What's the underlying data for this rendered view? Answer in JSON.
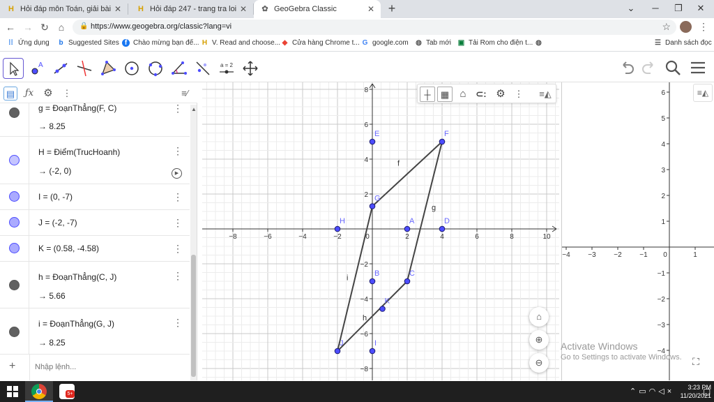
{
  "browser": {
    "tabs": [
      {
        "title": "Hỏi đáp môn Toán, giải bài tập c",
        "icon": "hoidap-icon",
        "active": false
      },
      {
        "title": "Hỏi đáp 247 - trang tra loi",
        "icon": "hoidap-icon",
        "active": false
      },
      {
        "title": "GeoGebra Classic",
        "icon": "geogebra-icon",
        "active": true
      }
    ],
    "url": "https://www.geogebra.org/classic?lang=vi",
    "bookmarks": [
      {
        "label": "Ứng dụng",
        "icon": "apps-icon"
      },
      {
        "label": "Suggested Sites",
        "icon": "bing-icon"
      },
      {
        "label": "Chào mừng bạn đế...",
        "icon": "facebook-icon"
      },
      {
        "label": "V. Read and choose...",
        "icon": "hoidap-icon"
      },
      {
        "label": "Cửa hàng Chrome t...",
        "icon": "chrome-store-icon"
      },
      {
        "label": "google.com",
        "icon": "google-icon"
      },
      {
        "label": "Tab mới",
        "icon": "globe-icon"
      },
      {
        "label": "Tải Rom cho điện t...",
        "icon": "rom-icon"
      }
    ],
    "reading_list": "Danh sách đọc"
  },
  "toolbar": {
    "tools": [
      "move-tool",
      "point-tool",
      "line-tool",
      "perpendicular-tool",
      "polygon-tool",
      "circle-tool",
      "conic-tool",
      "angle-tool",
      "reflect-tool",
      "slider-tool",
      "move-graphics-tool"
    ],
    "slider_label": "a = 2"
  },
  "algebra": {
    "items": [
      {
        "def": "g = ĐoạnThẳng(F, C)",
        "value": "→ 8.25",
        "color": "#616161"
      },
      {
        "def": "H = Điểm(TrucHoanh)",
        "value": "→ (-2, 0)",
        "color": "#aaaaff"
      },
      {
        "def": "I = (0, -7)",
        "value": "",
        "color": "#4d4dff"
      },
      {
        "def": "J = (-2, -7)",
        "value": "",
        "color": "#4d4dff"
      },
      {
        "def": "K = (0.58, -4.58)",
        "value": "",
        "color": "#4d4dff"
      },
      {
        "def": "h = ĐoạnThẳng(C, J)",
        "value": "→ 5.66",
        "color": "#616161"
      },
      {
        "def": "i = ĐoạnThẳng(G, J)",
        "value": "→ 8.25",
        "color": "#616161"
      }
    ],
    "input_placeholder": "Nhập lệnh..."
  },
  "graphics": {
    "x_ticks": [
      "−8",
      "−6",
      "−4",
      "−2",
      "0",
      "2",
      "4",
      "6",
      "8",
      "10"
    ],
    "y_ticks": [
      "8",
      "6",
      "4",
      "2",
      "−2",
      "−4",
      "−6",
      "−8"
    ],
    "points": [
      {
        "name": "E",
        "x": 0,
        "y": 5
      },
      {
        "name": "F",
        "x": 4,
        "y": 5
      },
      {
        "name": "G",
        "x": 0,
        "y": 1.3
      },
      {
        "name": "H",
        "x": -2,
        "y": 0
      },
      {
        "name": "A",
        "x": 2,
        "y": 0
      },
      {
        "name": "D",
        "x": 4,
        "y": 0
      },
      {
        "name": "B",
        "x": 0,
        "y": -3
      },
      {
        "name": "C",
        "x": 2,
        "y": -3
      },
      {
        "name": "K",
        "x": 0.58,
        "y": -4.58
      },
      {
        "name": "J",
        "x": -2,
        "y": -7
      },
      {
        "name": "I",
        "x": 0,
        "y": -7
      }
    ],
    "segments": [
      {
        "name": "f",
        "from": "G",
        "to": "F"
      },
      {
        "name": "g",
        "from": "F",
        "to": "C"
      },
      {
        "name": "h",
        "from": "C",
        "to": "J"
      },
      {
        "name": "i",
        "from": "G",
        "to": "J"
      }
    ],
    "point_color": "#4d4dff",
    "label_color": "#6868ff",
    "segment_color": "#444444"
  },
  "graphics2": {
    "x_ticks": [
      "−4",
      "−3",
      "−2",
      "−1",
      "0",
      "1"
    ],
    "y_ticks": [
      "6",
      "5",
      "4",
      "3",
      "2",
      "1",
      "−1",
      "−2",
      "−3",
      "−4"
    ]
  },
  "watermark": {
    "line1": "Activate Windows",
    "line2": "Go to Settings to activate Windows."
  },
  "taskbar": {
    "time": "3:23 PM",
    "date": "11/20/2021",
    "tray_icons": [
      "chevron-up-icon",
      "battery-icon",
      "wifi-icon",
      "volume-icon",
      "notification-icon"
    ]
  }
}
